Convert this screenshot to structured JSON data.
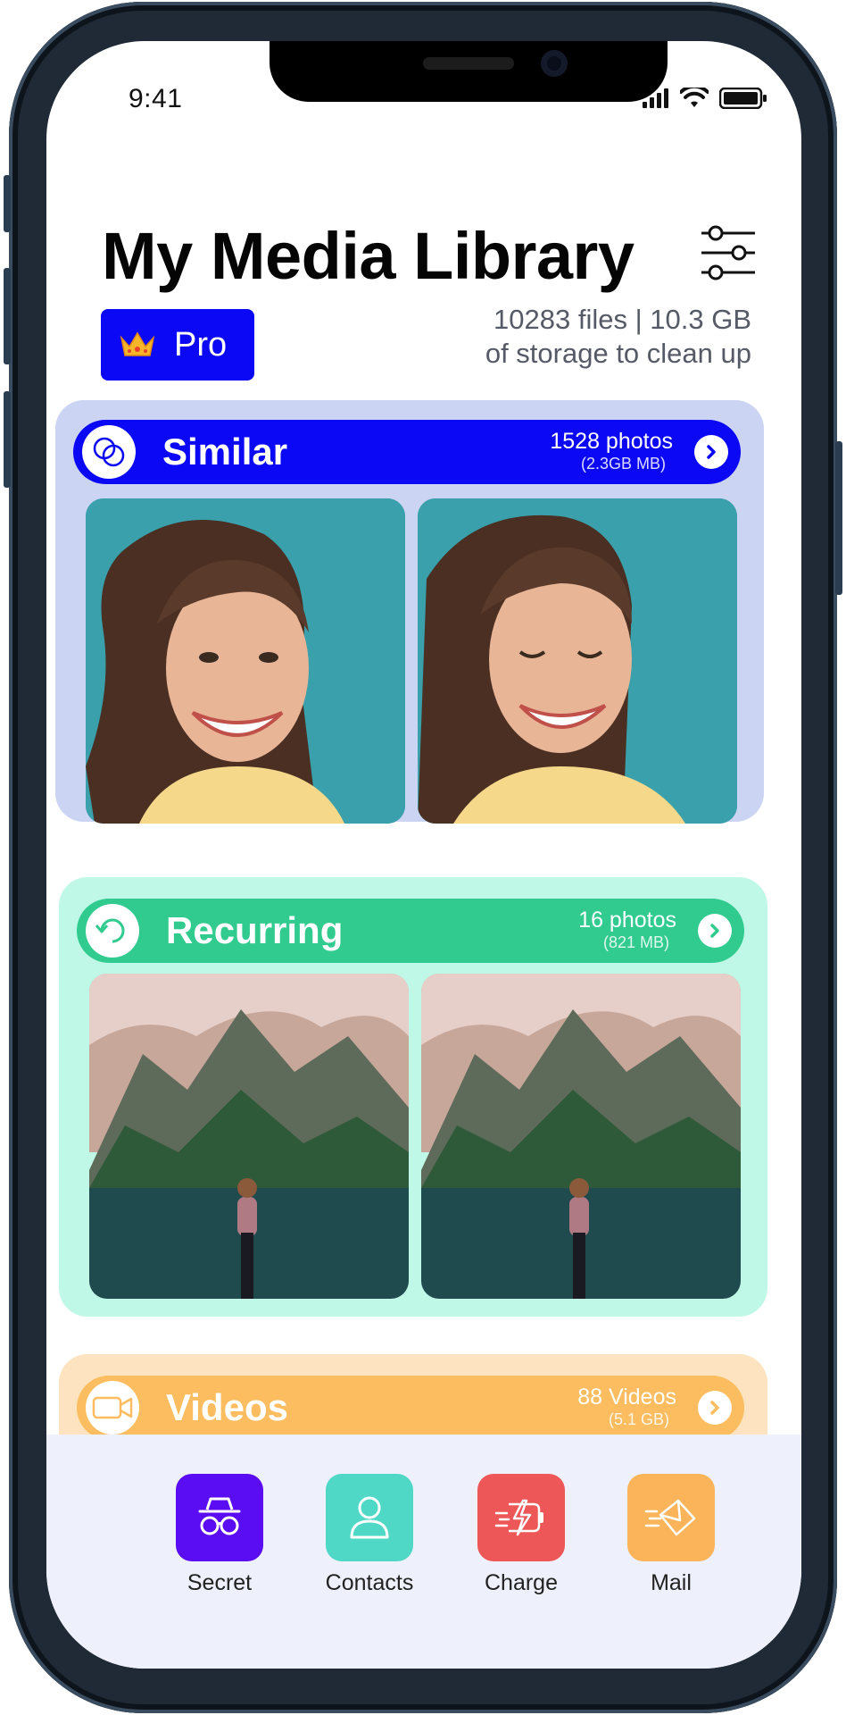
{
  "status_bar": {
    "time": "9:41"
  },
  "header": {
    "title": "My Media Library",
    "pro_label": "Pro",
    "storage_line1": "10283 files | 10.3 GB",
    "storage_line2": "of storage to clean up"
  },
  "cards": [
    {
      "title": "Similar",
      "count": "1528 photos",
      "size": "(2.3GB MB)",
      "color": "#0b08f5",
      "bg": "#ccd4f4",
      "icon": "overlap-circles-icon"
    },
    {
      "title": "Recurring",
      "count": "16 photos",
      "size": "(821 MB)",
      "color": "#31cb8f",
      "bg": "#bff8e6",
      "icon": "refresh-icon"
    },
    {
      "title": "Videos",
      "count": "88 Videos",
      "size": "(5.1 GB)",
      "color": "#fbbd5f",
      "bg": "#fde3bf",
      "icon": "video-camera-icon"
    }
  ],
  "dock": [
    {
      "label": "Secret",
      "color": "#5a0cf2",
      "icon": "incognito-icon"
    },
    {
      "label": "Contacts",
      "color": "#50d8c6",
      "icon": "person-icon"
    },
    {
      "label": "Charge",
      "color": "#ee5757",
      "icon": "battery-charge-icon"
    },
    {
      "label": "Mail",
      "color": "#fbb45a",
      "icon": "mail-icon"
    }
  ],
  "colors": {
    "accent": "#0b08f5"
  }
}
